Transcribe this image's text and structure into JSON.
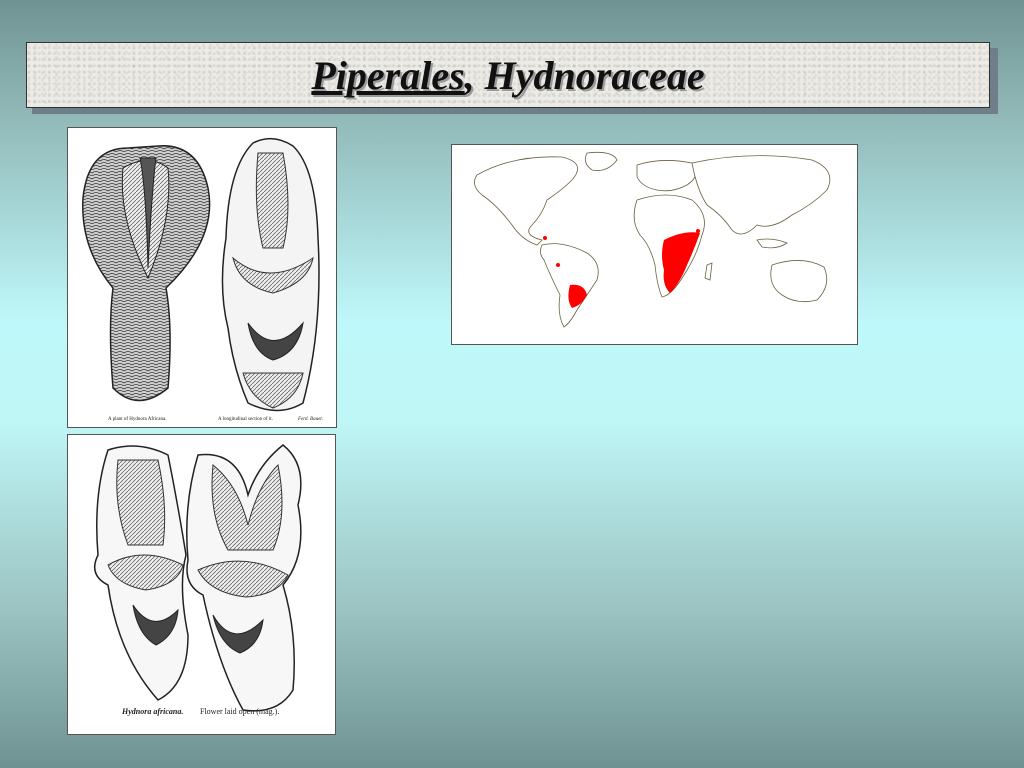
{
  "title": {
    "part1": "Piperales",
    "part2": ", Hydnoraceae"
  },
  "images": {
    "top": {
      "icon": "plant-illustration",
      "caption_left": "A plant of Hydnora Africana.",
      "caption_right": "A longitudinal section of it.",
      "caption_credit": "Ferd. Bauer."
    },
    "bottom": {
      "icon": "flower-illustration",
      "caption_species": "Hydnora africana.",
      "caption_text": "Flower laid open (mag.)."
    },
    "map": {
      "icon": "world-distribution-map",
      "highlight_color": "#ff0000"
    }
  }
}
